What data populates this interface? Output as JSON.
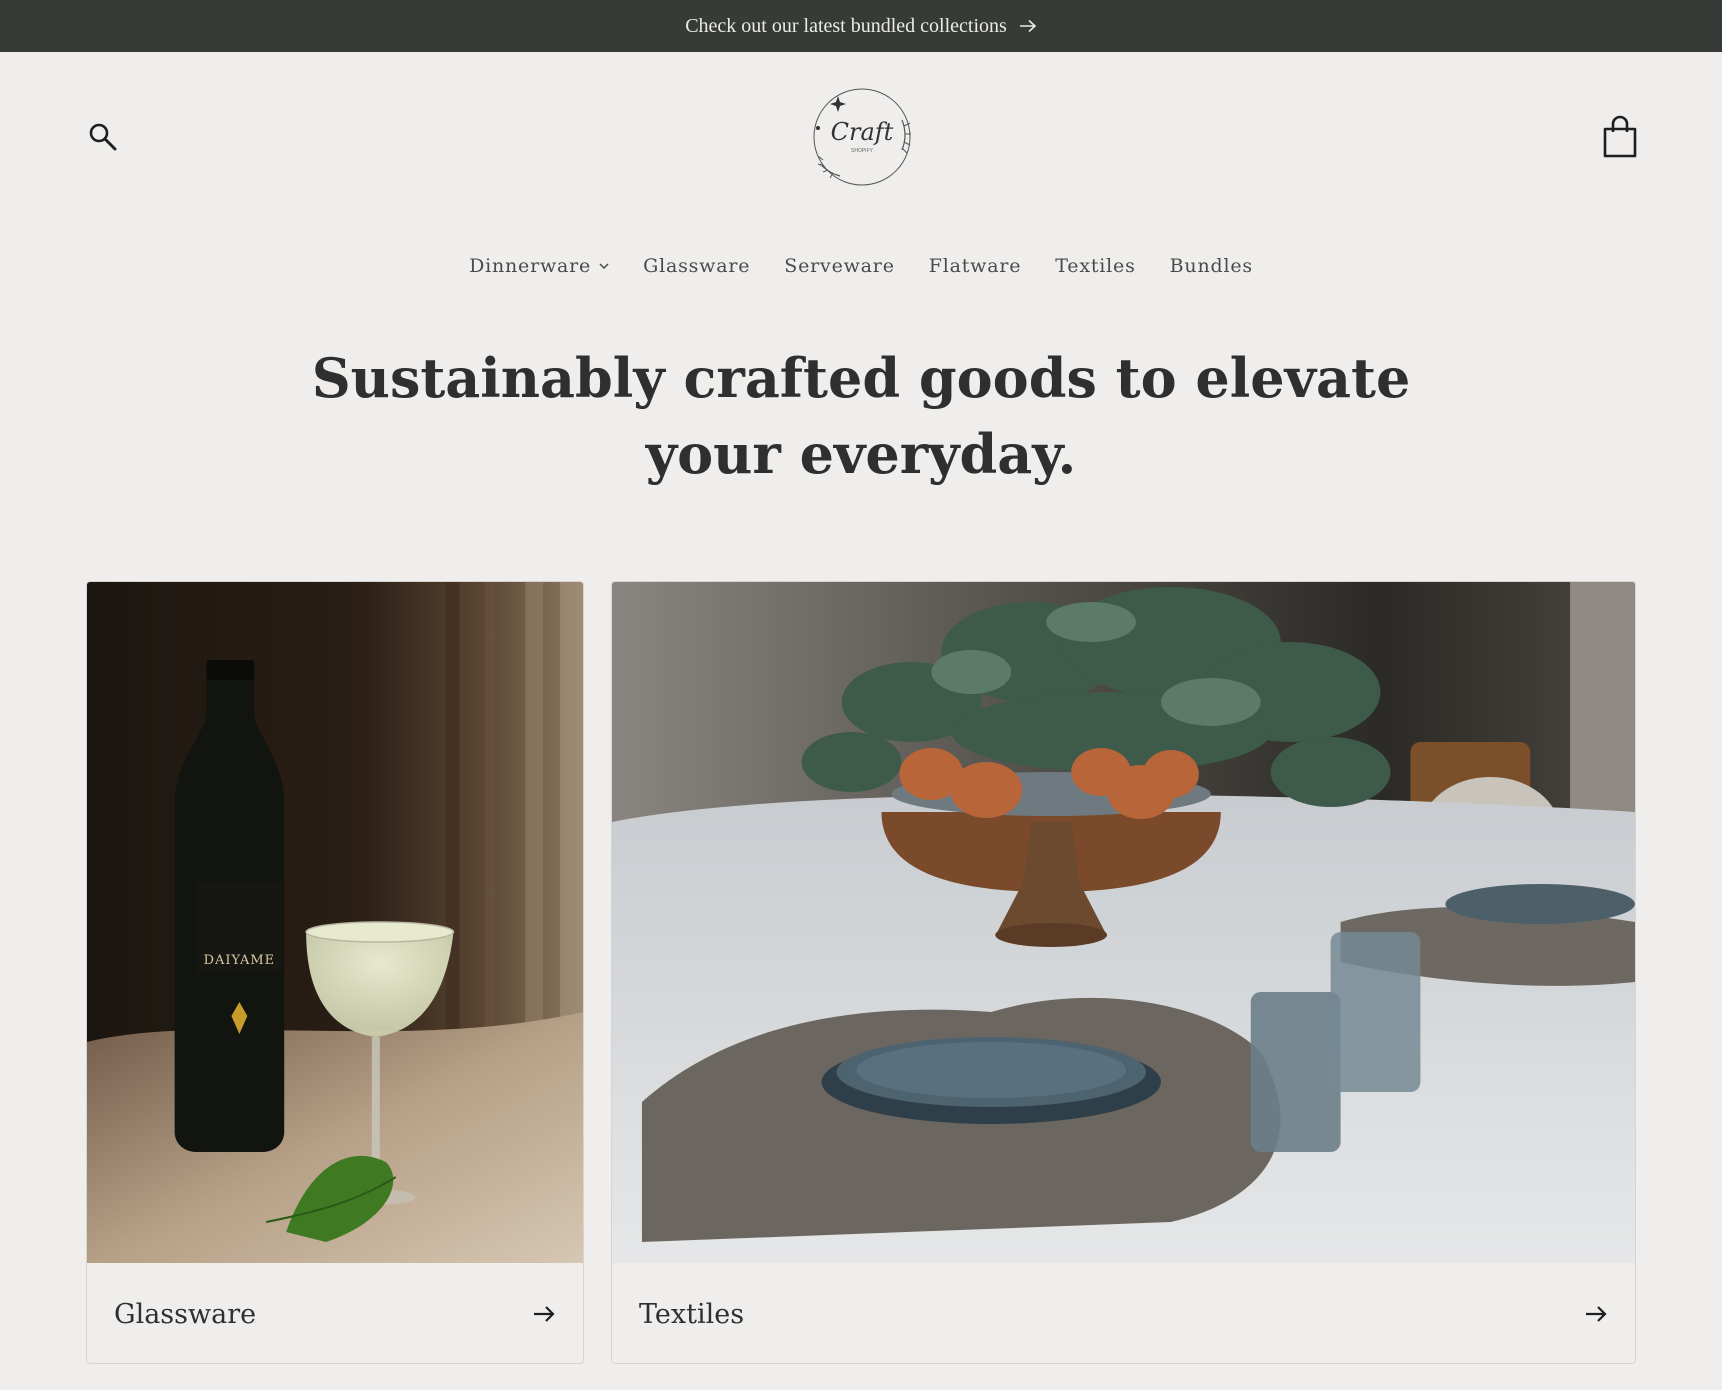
{
  "announcement": {
    "text": "Check out our latest bundled collections",
    "icon": "arrow-right-icon"
  },
  "header": {
    "search_icon": "search-icon",
    "cart_icon": "shopping-bag-icon",
    "logo": {
      "wordmark": "Craft",
      "subtext": "SHOPIFY"
    }
  },
  "nav": {
    "items": [
      {
        "label": "Dinnerware",
        "has_dropdown": true
      },
      {
        "label": "Glassware"
      },
      {
        "label": "Serveware"
      },
      {
        "label": "Flatware"
      },
      {
        "label": "Textiles"
      },
      {
        "label": "Bundles"
      }
    ]
  },
  "hero": {
    "line1": "Sustainably crafted goods to elevate",
    "line2": "your everyday."
  },
  "collections": [
    {
      "title": "Glassware",
      "image_label": "DAIYAME",
      "icon": "arrow-right-icon"
    },
    {
      "title": "Textiles",
      "icon": "arrow-right-icon"
    }
  ],
  "colors": {
    "announcement_bg": "#363b38",
    "page_bg": "#efeeec",
    "text": "#2f2f2f"
  }
}
